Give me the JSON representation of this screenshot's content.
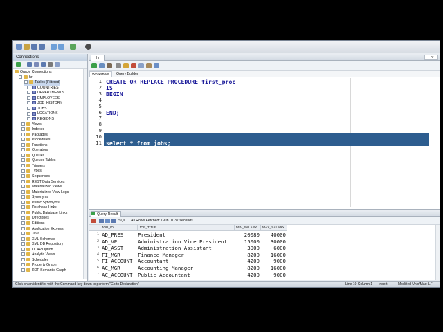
{
  "toolbar": {
    "icons": [
      "new-icon",
      "open-icon",
      "save-icon",
      "save-all-icon",
      "back-icon",
      "forward-icon",
      "run-icon",
      "debug-icon",
      "bug-icon"
    ]
  },
  "connections": {
    "title": "Connections",
    "tree": [
      {
        "label": "Oracle Connections",
        "type": "root"
      },
      {
        "label": "hr",
        "type": "conn"
      },
      {
        "label": "Tables (Filtered)",
        "type": "folder",
        "selected": true
      },
      {
        "label": "COUNTRIES",
        "type": "table"
      },
      {
        "label": "DEPARTMENTS",
        "type": "table"
      },
      {
        "label": "EMPLOYEES",
        "type": "table"
      },
      {
        "label": "JOB_HISTORY",
        "type": "table"
      },
      {
        "label": "JOBS",
        "type": "table"
      },
      {
        "label": "LOCATIONS",
        "type": "table"
      },
      {
        "label": "REGIONS",
        "type": "table"
      },
      {
        "label": "Views",
        "type": "folder"
      },
      {
        "label": "Indexes",
        "type": "folder"
      },
      {
        "label": "Packages",
        "type": "folder"
      },
      {
        "label": "Procedures",
        "type": "folder"
      },
      {
        "label": "Functions",
        "type": "folder"
      },
      {
        "label": "Operators",
        "type": "folder"
      },
      {
        "label": "Queues",
        "type": "folder"
      },
      {
        "label": "Queues Tables",
        "type": "folder"
      },
      {
        "label": "Triggers",
        "type": "folder"
      },
      {
        "label": "Types",
        "type": "folder"
      },
      {
        "label": "Sequences",
        "type": "folder"
      },
      {
        "label": "REST Data Services",
        "type": "folder"
      },
      {
        "label": "Materialized Views",
        "type": "folder"
      },
      {
        "label": "Materialized View Logs",
        "type": "folder"
      },
      {
        "label": "Synonyms",
        "type": "folder"
      },
      {
        "label": "Public Synonyms",
        "type": "folder"
      },
      {
        "label": "Database Links",
        "type": "folder"
      },
      {
        "label": "Public Database Links",
        "type": "folder"
      },
      {
        "label": "Directories",
        "type": "folder"
      },
      {
        "label": "Editions",
        "type": "folder"
      },
      {
        "label": "Application Express",
        "type": "folder"
      },
      {
        "label": "Java",
        "type": "folder"
      },
      {
        "label": "XML Schemas",
        "type": "folder"
      },
      {
        "label": "XML DB Repository",
        "type": "folder"
      },
      {
        "label": "OLAP Option",
        "type": "folder"
      },
      {
        "label": "Analytic Views",
        "type": "folder"
      },
      {
        "label": "Scheduler",
        "type": "folder"
      },
      {
        "label": "Property Graph",
        "type": "folder"
      },
      {
        "label": "RDF Semantic Graph",
        "type": "folder"
      }
    ]
  },
  "editor": {
    "tab_label": "hr",
    "search_label": "hr",
    "subtabs": [
      "Worksheet",
      "Query Builder"
    ],
    "lines": [
      {
        "n": "1",
        "text": "CREATE OR REPLACE PROCEDURE first_proc"
      },
      {
        "n": "2",
        "text": "IS"
      },
      {
        "n": "3",
        "text": "BEGIN"
      },
      {
        "n": "4",
        "text": ""
      },
      {
        "n": "5",
        "text": ""
      },
      {
        "n": "6",
        "text": "END;"
      },
      {
        "n": "7",
        "text": ""
      },
      {
        "n": "8",
        "text": ""
      },
      {
        "n": "9",
        "text": ""
      },
      {
        "n": "10",
        "text": ""
      },
      {
        "n": "11",
        "text": "select * from jobs;"
      }
    ]
  },
  "results": {
    "tab_label": "Query Result",
    "sql_label": "SQL",
    "fetch_status": "All Rows Fetched: 19 in 0.037 seconds",
    "columns": [
      "JOB_ID",
      "JOB_TITLE",
      "MIN_SALARY",
      "MAX_SALARY"
    ],
    "rows": [
      {
        "n": "1",
        "job_id": "AD_PRES",
        "title": "President",
        "min": "20080",
        "max": "40000"
      },
      {
        "n": "2",
        "job_id": "AD_VP",
        "title": "Administration Vice President",
        "min": "15000",
        "max": "30000"
      },
      {
        "n": "3",
        "job_id": "AD_ASST",
        "title": "Administration Assistant",
        "min": "3000",
        "max": "6000"
      },
      {
        "n": "4",
        "job_id": "FI_MGR",
        "title": "Finance Manager",
        "min": "8200",
        "max": "16000"
      },
      {
        "n": "5",
        "job_id": "FI_ACCOUNT",
        "title": "Accountant",
        "min": "4200",
        "max": "9000"
      },
      {
        "n": "6",
        "job_id": "AC_MGR",
        "title": "Accounting Manager",
        "min": "8200",
        "max": "16000"
      },
      {
        "n": "7",
        "job_id": "AC_ACCOUNT",
        "title": "Public Accountant",
        "min": "4200",
        "max": "9000"
      }
    ]
  },
  "status": {
    "hint": "Click on an identifier with the Command key down to perform \"Go to Declaration\"",
    "position": "Line 10 Column 1",
    "mode": "Insert",
    "modified": "Modified  Unix/Mac: LF"
  },
  "colors": {
    "selection": "#2d5d8f",
    "keyword": "#1a1a9a",
    "panel_bg": "#e8ecf1"
  }
}
